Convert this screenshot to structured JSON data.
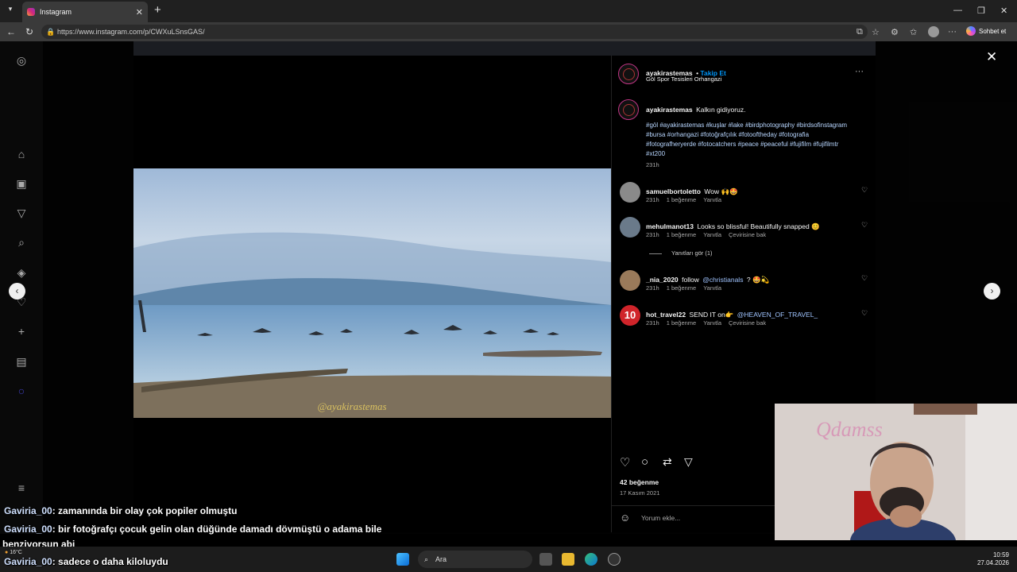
{
  "browser": {
    "tab_title": "Instagram",
    "url": "https://www.instagram.com/p/CWXuLSnsGAS/",
    "copilot_label": "Sohbet et"
  },
  "post": {
    "author": "ayakirastemas",
    "follow_label": "Takip Et",
    "location": "Göl Spor Tesisleri Orhangazi",
    "caption_text": "Kalkın gidiyoruz.",
    "hashtags": "#göl #ayakirastemas #kuşlar #lake #birdphotography #birdsofinstagram #bursa #orhangazi #fotoğrafçılık #fotooftheday #fotografia #fotografheryerde #fotocatchers #peace #peaceful #fujifilm #fujifilmtr #xt200",
    "caption_time": "231h",
    "watermark": "@ayakirastemas",
    "likes": "42 beğenme",
    "date": "17 Kasım 2021",
    "comment_placeholder": "Yorum ekle..."
  },
  "comments": [
    {
      "user": "samuelbortoletto",
      "text": "Wow 🙌🤩",
      "time": "231h",
      "likes": "1 beğenme",
      "reply": "Yanıtla",
      "translate": ""
    },
    {
      "user": "mehulmanot13",
      "text": "Looks so blissful! Beautifully snapped 😊",
      "time": "231h",
      "likes": "1 beğenme",
      "reply": "Yanıtla",
      "translate": "Çevirisine bak"
    },
    {
      "user": "_nia_2020",
      "text": "follow",
      "mention": "@christianals",
      "after": "? 🤩💫",
      "time": "231h",
      "likes": "1 beğenme",
      "reply": "Yanıtla",
      "translate": ""
    },
    {
      "user": "hot_travel22",
      "text": "SEND IT on👉",
      "mention": "@HEAVEN_OF_TRAVEL_",
      "time": "231h",
      "likes": "1 beğenme",
      "reply": "Yanıtla",
      "translate": "Çevirisine bak"
    }
  ],
  "view_replies": "Yanıtları gör (1)",
  "webcam_sign": "Qdamss",
  "chat": [
    {
      "name": "Gaviria_00",
      "msg": ": zamanında bir olay çok popiler olmuştu"
    },
    {
      "name": "Gaviria_00",
      "msg": ": bir fotoğrafçı çocuk gelin olan düğünde damadı dövmüştü o adama bile"
    },
    {
      "name": "",
      "msg": "benziyorsun abi"
    },
    {
      "name": "Gaviria_00",
      "msg": ": sadece o daha kiloluydu"
    }
  ],
  "taskbar": {
    "search_label": "Ara",
    "weather": "16°C",
    "time": "10:59",
    "date": "27.04.2026"
  }
}
